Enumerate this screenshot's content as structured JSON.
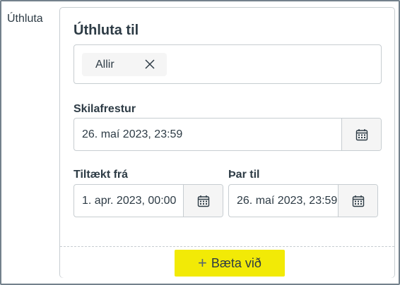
{
  "side_label": "Úthluta",
  "card": {
    "title": "Úthluta til",
    "assignees": [
      {
        "label": "Allir"
      }
    ],
    "due": {
      "label": "Skilafrestur",
      "value": "26. maí 2023, 23:59"
    },
    "available_from": {
      "label": "Tiltækt frá",
      "value": "1. apr. 2023, 00:00"
    },
    "until": {
      "label": "Þar til",
      "value": "26. maí 2023, 23:59"
    },
    "add_button": {
      "icon": "+",
      "label": "Bæta við"
    }
  },
  "colors": {
    "highlight": "#f2ea06",
    "border": "#c7cdd1",
    "text": "#2d3b45"
  }
}
